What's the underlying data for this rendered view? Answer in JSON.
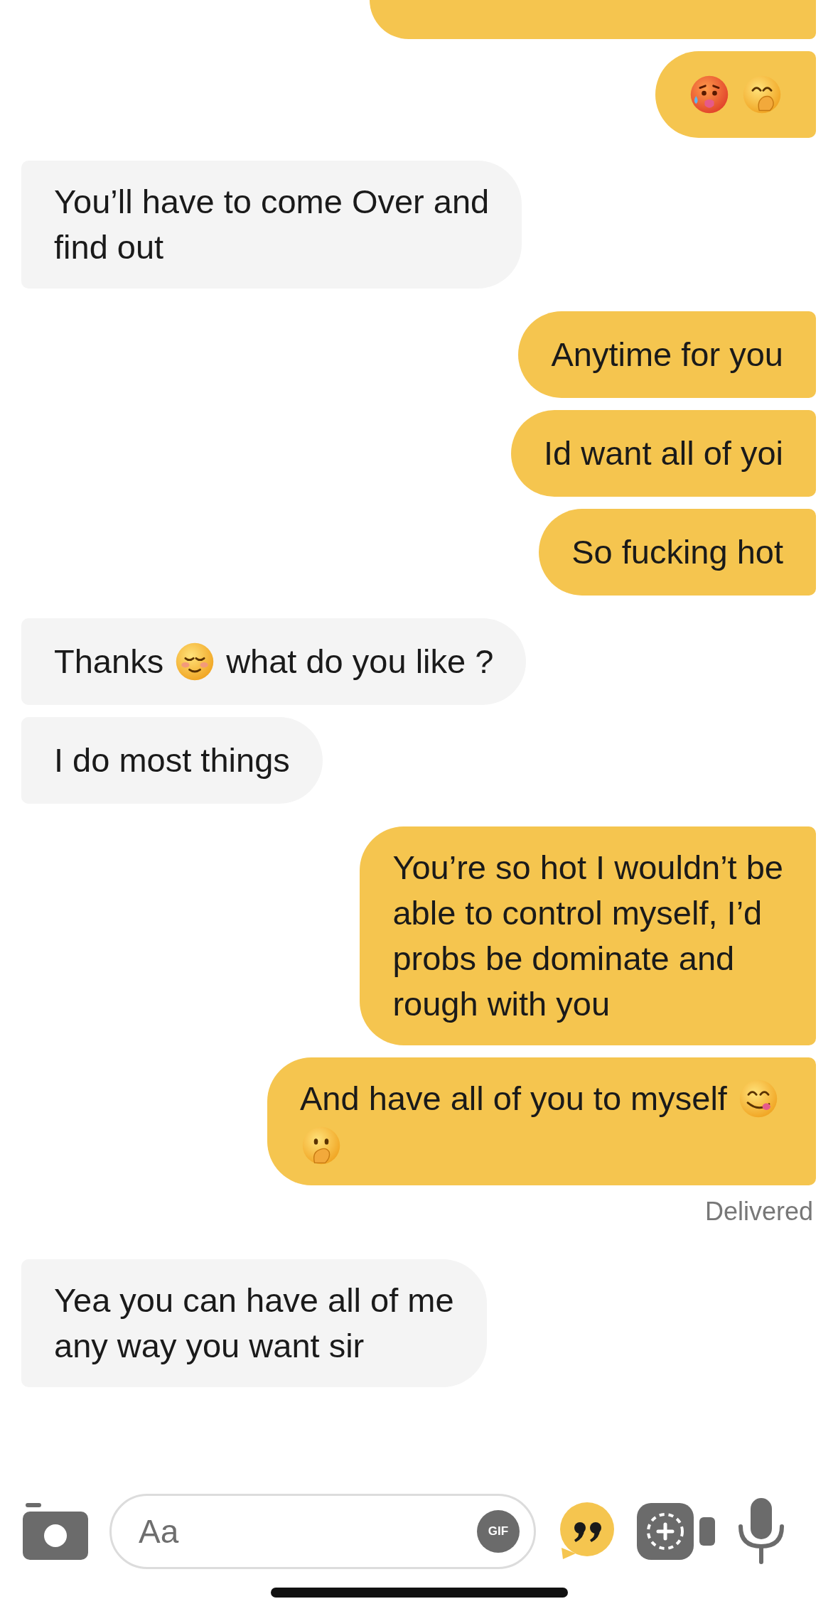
{
  "messages": [
    {
      "outgoing": true,
      "kind": "clipped"
    },
    {
      "outgoing": true,
      "kind": "message",
      "parts": [
        {
          "kind": "hot"
        },
        {
          "kind": "giggle"
        }
      ]
    },
    {
      "outgoing": false,
      "kind": "message",
      "parts": [
        {
          "kind": "text",
          "text": "You’ll have to come Over and\nfind out"
        }
      ]
    },
    {
      "outgoing": true,
      "kind": "message",
      "parts": [
        {
          "kind": "text",
          "text": "Anytime for you"
        }
      ]
    },
    {
      "outgoing": true,
      "kind": "message",
      "parts": [
        {
          "kind": "text",
          "text": "Id want all of yoi"
        }
      ]
    },
    {
      "outgoing": true,
      "kind": "message",
      "parts": [
        {
          "kind": "text",
          "text": "So fucking hot"
        }
      ]
    },
    {
      "outgoing": false,
      "kind": "message",
      "parts": [
        {
          "kind": "text",
          "text": "Thanks"
        },
        {
          "kind": "blush"
        },
        {
          "kind": "text",
          "text": "what do you like ?"
        }
      ]
    },
    {
      "outgoing": false,
      "kind": "message",
      "parts": [
        {
          "kind": "text",
          "text": "I do most things"
        }
      ]
    },
    {
      "outgoing": true,
      "kind": "message",
      "parts": [
        {
          "kind": "text",
          "text": "You’re so hot I wouldn’t be\nable to control myself, I’d\nprobs be dominate and\nrough with you"
        }
      ]
    },
    {
      "outgoing": true,
      "kind": "message",
      "parts": [
        {
          "kind": "text",
          "text": "And have all of you to myself"
        },
        {
          "kind": "yum"
        },
        {
          "kind": "shy"
        }
      ]
    },
    {
      "kind": "status",
      "text": "Delivered"
    },
    {
      "outgoing": false,
      "kind": "message",
      "parts": [
        {
          "kind": "text",
          "text": "Yea you can have all of me\nany way you want sir"
        }
      ]
    }
  ],
  "composer": {
    "placeholder": "Aa",
    "gif": "GIF"
  }
}
